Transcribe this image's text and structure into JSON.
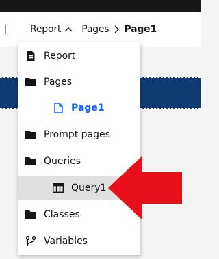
{
  "breadcrumb": {
    "items": [
      {
        "label": "Report"
      },
      {
        "label": "Pages"
      },
      {
        "label": "Page1"
      }
    ]
  },
  "dropdown": {
    "items": [
      {
        "label": "Report",
        "icon": "document-icon"
      },
      {
        "label": "Pages",
        "icon": "folder-icon"
      },
      {
        "label": "Page1",
        "icon": "page-icon",
        "state": "current"
      },
      {
        "label": "Prompt pages",
        "icon": "folder-icon"
      },
      {
        "label": "Queries",
        "icon": "folder-icon"
      },
      {
        "label": "Query1",
        "icon": "table-icon",
        "state": "hover"
      },
      {
        "label": "Classes",
        "icon": "folder-icon"
      },
      {
        "label": "Variables",
        "icon": "branch-icon"
      }
    ]
  },
  "colors": {
    "accent": "#0f62fe",
    "arrow": "#e8101b",
    "band": "#0f3b73"
  }
}
